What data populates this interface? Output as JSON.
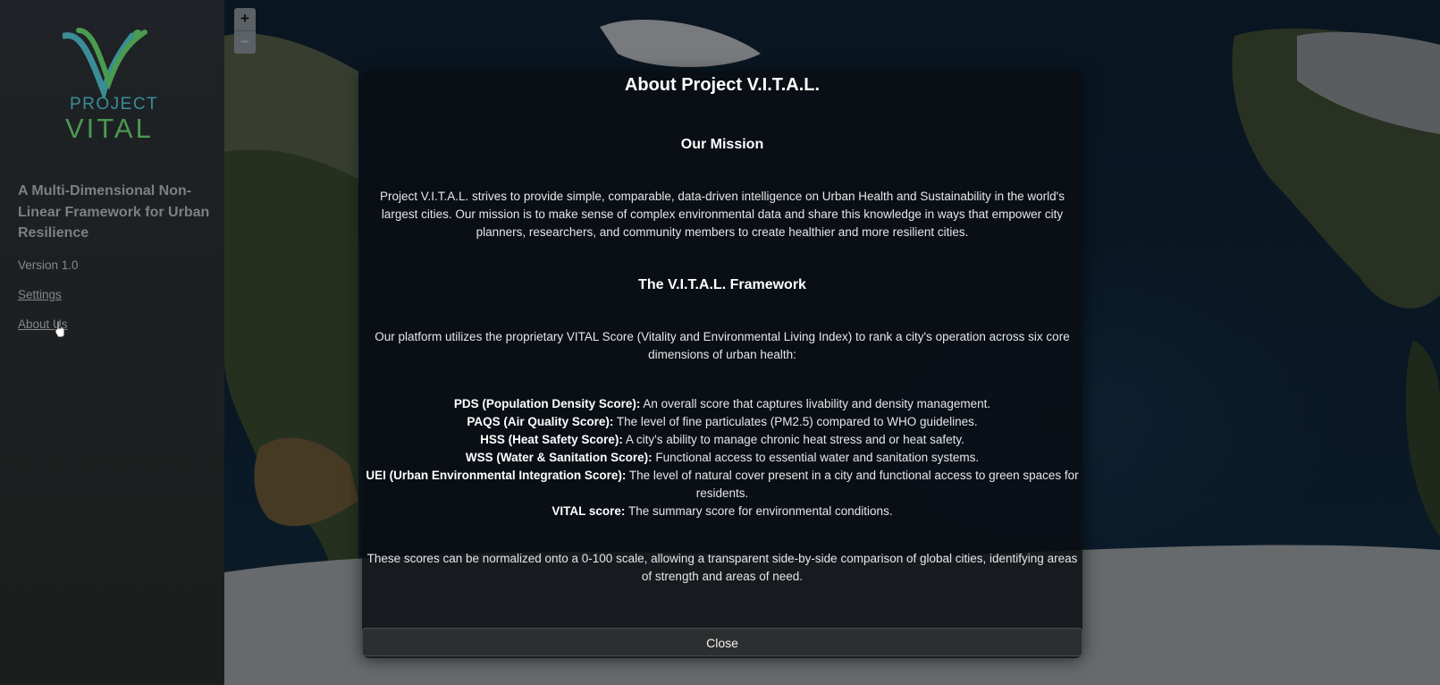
{
  "sidebar": {
    "logo": {
      "line1": "PROJECT",
      "line2": "VITAL"
    },
    "tagline": "A Multi-Dimensional Non-Linear Framework for Urban Resilience",
    "version": "Version 1.0",
    "links": {
      "settings": "Settings",
      "about": "About Us"
    }
  },
  "map": {
    "zoom_in": "+",
    "zoom_out": "−"
  },
  "modal": {
    "title": "About Project V.I.T.A.L.",
    "mission_heading": "Our Mission",
    "mission_text": "Project V.I.T.A.L. strives to provide simple, comparable, data-driven intelligence on Urban Health and Sustainability in the world's largest cities. Our mission is to make sense of complex environmental data and share this knowledge in ways that empower city planners, researchers, and community members to create healthier and more resilient cities.",
    "framework_heading": "The V.I.T.A.L. Framework",
    "framework_text": "Our platform utilizes the proprietary VITAL Score (Vitality and Environmental Living Index) to rank a city's operation across six core dimensions of urban health:",
    "scores": [
      {
        "name": "PDS (Population Density Score):",
        "desc": " An overall score that captures livability and density management."
      },
      {
        "name": "PAQS (Air Quality Score):",
        "desc": " The level of fine particulates (PM2.5) compared to WHO guidelines."
      },
      {
        "name": "HSS (Heat Safety Score):",
        "desc": " A city's ability to manage chronic heat stress and or heat safety."
      },
      {
        "name": "WSS (Water & Sanitation Score):",
        "desc": " Functional access to essential water and sanitation systems."
      },
      {
        "name": "UEI (Urban Environmental Integration Score):",
        "desc": " The level of natural cover present in a city and functional access to green spaces for residents."
      },
      {
        "name": "VITAL score:",
        "desc": " The summary score for environmental conditions."
      }
    ],
    "normalize_text": "These scores can be normalized onto a 0-100 scale, allowing a transparent side-by-side comparison of global cities, identifying areas of strength and areas of need.",
    "close_label": "Close"
  },
  "colors": {
    "logo_teal": "#3a8d96",
    "logo_green": "#4a9a50",
    "modal_bg": "#0a0e14",
    "sidebar_bg": "#1f2226"
  }
}
